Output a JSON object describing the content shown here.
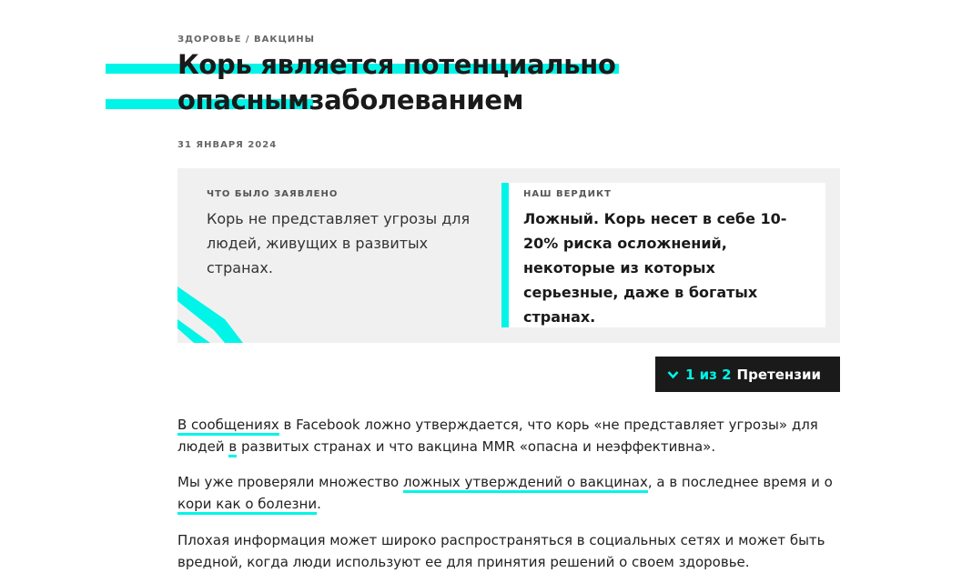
{
  "colors": {
    "accent": "#00f5e8",
    "dark": "#1a1a1a",
    "box_bg": "#f0f0f0"
  },
  "breadcrumb": "ЗДОРОВЬЕ / ВАКЦИНЫ",
  "title": {
    "line1": "Корь является потенциально",
    "line2_highlight": "опасным",
    "line2_rest": "заболеванием"
  },
  "date": "31 ЯНВАРЯ 2024",
  "claim": {
    "label": "ЧТО БЫЛО ЗАЯВЛЕНО",
    "text": "Корь не представляет угрозы для людей, живущих в развитых странах."
  },
  "verdict": {
    "label": "НАШ ВЕРДИКТ",
    "text": "Ложный. Корь несет в себе 10-20% риска осложнений, некоторые из которых серьезные, даже в богатых странах."
  },
  "pager": {
    "icon": "chevron-down-icon",
    "count": "1 из 2",
    "label": "Претензии"
  },
  "paragraphs": {
    "p1": {
      "link1": "В сообщениях",
      "text1": " в Facebook ложно утверждается, что корь «не представляет угрозы» для людей ",
      "link2": "в",
      "text2": " развитых странах и что вакцина MMR «опасна и неэффективна»."
    },
    "p2": {
      "text1": "Мы уже проверяли множество ",
      "link1": "ложных утверждений о вакцинах",
      "text2": ", а в последнее время и о ",
      "link2": "кори как о болезни",
      "text3": "."
    },
    "p3": {
      "text": "Плохая информация может широко распространяться в социальных сетях и может быть вредной, когда люди используют ее для принятия решений о своем здоровье."
    }
  }
}
